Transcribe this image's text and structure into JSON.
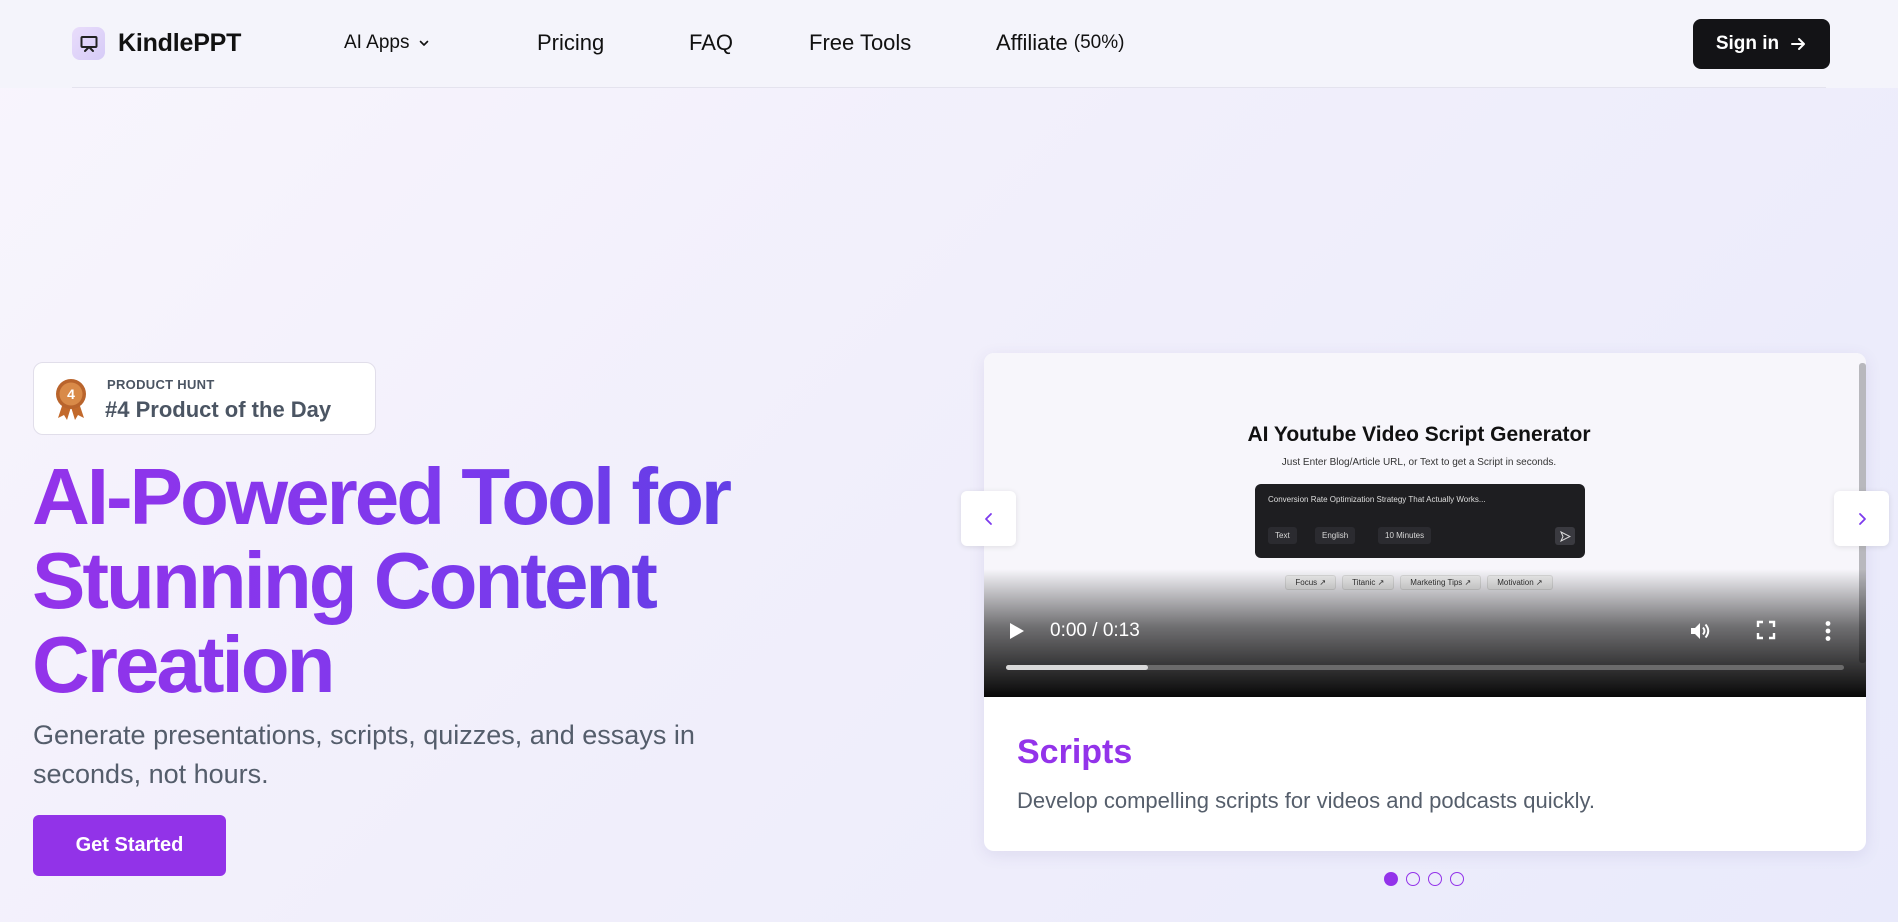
{
  "nav": {
    "brand": "KindlePPT",
    "ai_apps": "AI Apps",
    "pricing": "Pricing",
    "faq": "FAQ",
    "free_tools": "Free Tools",
    "affiliate": "Affiliate",
    "affiliate_pct": "(50%)",
    "sign_in": "Sign in"
  },
  "badge": {
    "label": "PRODUCT HUNT",
    "title": "#4 Product of the Day",
    "rank": "4"
  },
  "hero": {
    "line1": "AI-Powered Tool for",
    "line2": "Stunning Content",
    "line3": "Creation",
    "subtitle": "Generate presentations, scripts, quizzes, and essays in seconds, not hours.",
    "cta": "Get Started"
  },
  "carousel": {
    "video": {
      "title": "AI Youtube Video Script Generator",
      "subtitle": "Just Enter Blog/Article URL, or Text to get a Script in seconds.",
      "input_text": "Conversion Rate Optimization Strategy That Actually Works...",
      "chip_type": "Text",
      "chip_lang": "English",
      "chip_length": "10 Minutes",
      "tags": [
        "Focus ↗",
        "Titanic ↗",
        "Marketing Tips ↗",
        "Motivation ↗"
      ],
      "time": "0:00 / 0:13",
      "progress": 0.17
    },
    "slide_title": "Scripts",
    "slide_desc": "Develop compelling scripts for videos and podcasts quickly.",
    "slide_count": 4,
    "active_slide": 0
  },
  "colors": {
    "accent": "#9333ea",
    "dark_button": "#131316"
  }
}
